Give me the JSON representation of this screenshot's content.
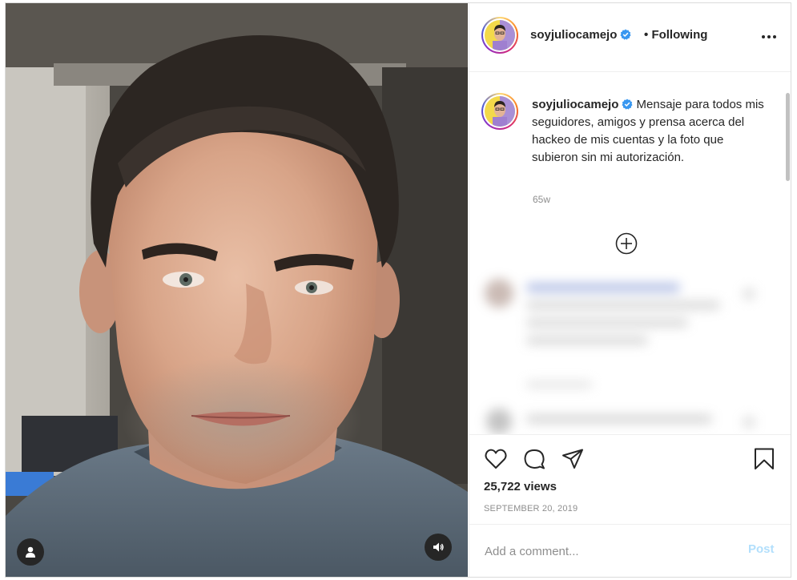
{
  "post": {
    "username": "soyjuliocamejo",
    "follow_separator": "•",
    "follow_label": "Following",
    "caption": "Mensaje para todos mis seguidores, amigos y prensa acerca del hackeo de mis cuentas y la foto que subieron sin mi autorización.",
    "time_ago": "65w",
    "views": "25,722 views",
    "date": "SEPTEMBER 20, 2019"
  },
  "comment_form": {
    "placeholder": "Add a comment...",
    "post_label": "Post"
  },
  "icons": {
    "verified": "verified-badge-icon",
    "more": "more-options-icon",
    "load_more": "plus-circle-icon",
    "like": "heart-icon",
    "comment": "comment-icon",
    "share": "paper-plane-icon",
    "save": "bookmark-icon",
    "user_tag": "user-icon",
    "audio": "speaker-icon"
  },
  "colors": {
    "verified_blue": "#3897f0",
    "post_button_disabled": "#b2dffc",
    "muted_text": "#8e8e8e",
    "border": "#efefef"
  }
}
